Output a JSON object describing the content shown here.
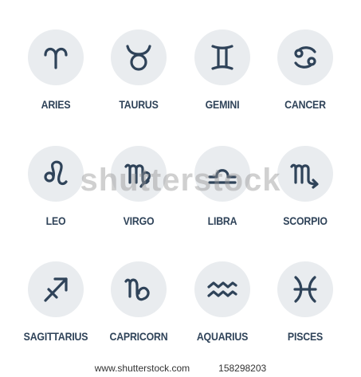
{
  "signs": [
    {
      "label": "ARIES",
      "icon": "aries-icon"
    },
    {
      "label": "TAURUS",
      "icon": "taurus-icon"
    },
    {
      "label": "GEMINI",
      "icon": "gemini-icon"
    },
    {
      "label": "CANCER",
      "icon": "cancer-icon"
    },
    {
      "label": "LEO",
      "icon": "leo-icon"
    },
    {
      "label": "VIRGO",
      "icon": "virgo-icon"
    },
    {
      "label": "LIBRA",
      "icon": "libra-icon"
    },
    {
      "label": "SCORPIO",
      "icon": "scorpio-icon"
    },
    {
      "label": "SAGITTARIUS",
      "icon": "sagittarius-icon"
    },
    {
      "label": "CAPRICORN",
      "icon": "capricorn-icon"
    },
    {
      "label": "AQUARIUS",
      "icon": "aquarius-icon"
    },
    {
      "label": "PISCES",
      "icon": "pisces-icon"
    }
  ],
  "watermark": "shutterstock",
  "footer": {
    "site": "www.shutterstock.com",
    "id": "158298203"
  },
  "colors": {
    "icon": "#2f4359",
    "circle": "#e9ecef"
  }
}
